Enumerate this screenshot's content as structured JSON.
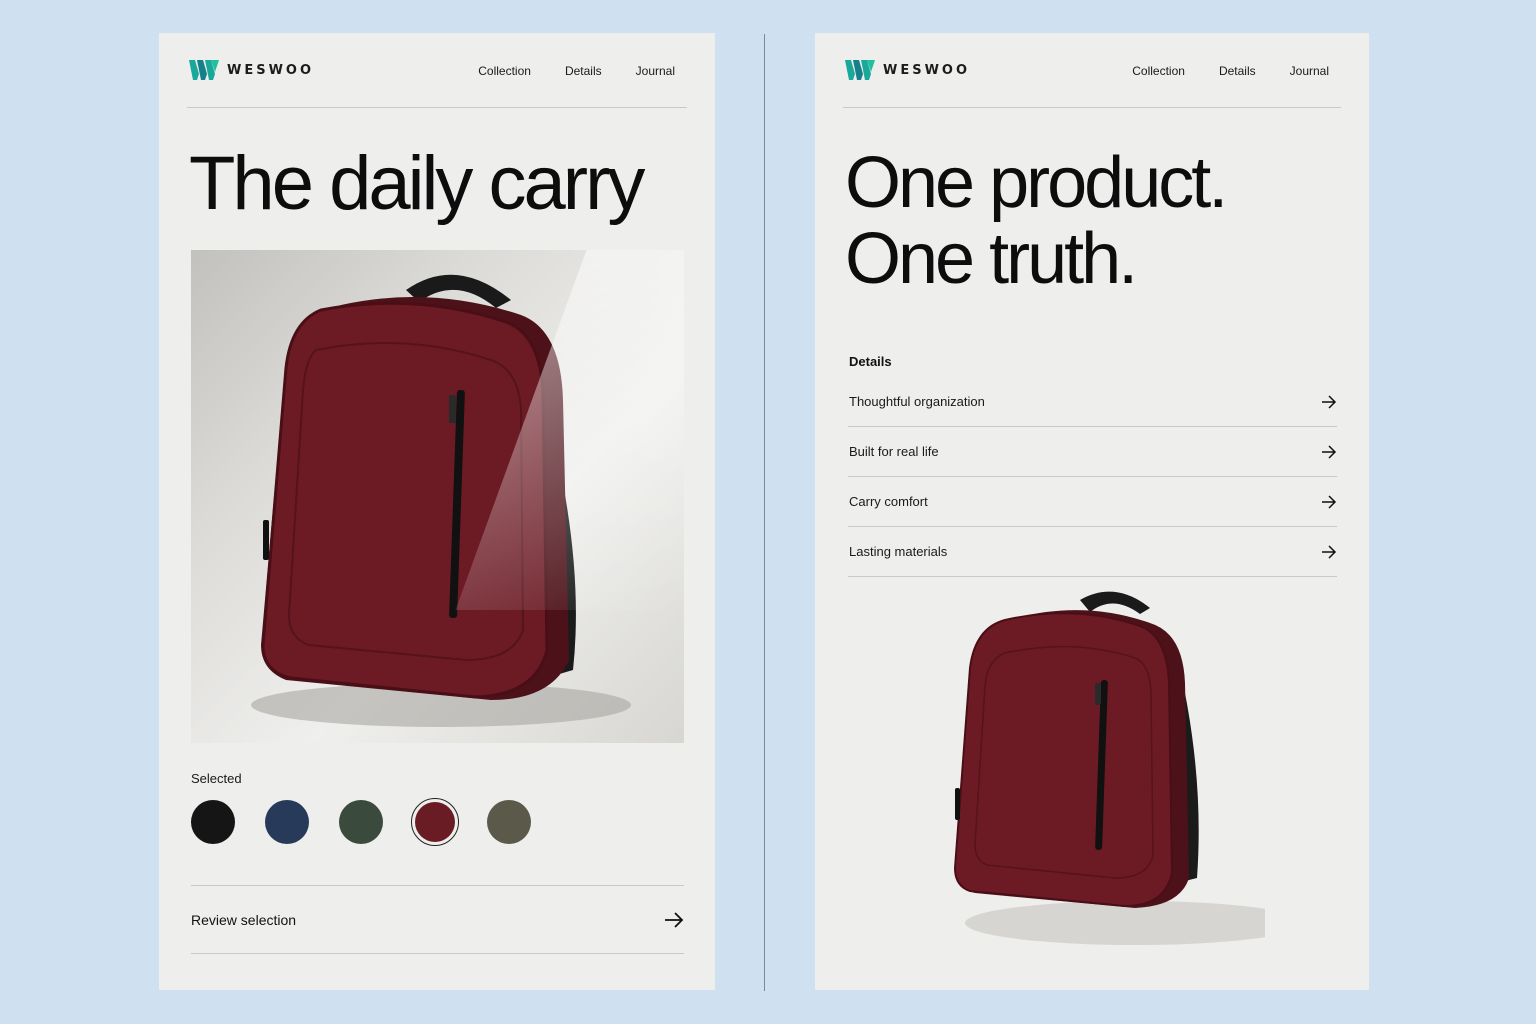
{
  "brand": {
    "name": "WESWOO",
    "accent_color": "#1aa89a",
    "icon": "weswoo-logo-icon"
  },
  "nav": {
    "items": [
      "Collection",
      "Details",
      "Journal"
    ]
  },
  "left_panel": {
    "headline": "The daily carry",
    "product_image": "maroon-backpack",
    "selected_label": "Selected",
    "swatches": [
      {
        "name": "black",
        "color": "#151515"
      },
      {
        "name": "navy",
        "color": "#273a5a"
      },
      {
        "name": "forest-green",
        "color": "#3a4a3c"
      },
      {
        "name": "burgundy",
        "color": "#6a1c24"
      },
      {
        "name": "olive",
        "color": "#5b5a4a"
      }
    ],
    "selected_swatch": "burgundy",
    "review_label": "Review selection",
    "review_icon": "arrow-right-icon"
  },
  "right_panel": {
    "headline_line1": "One product.",
    "headline_line2": "One truth.",
    "details_title": "Details",
    "details": [
      "Thoughtful organization",
      "Built for real life",
      "Carry comfort",
      "Lasting materials"
    ],
    "product_image": "maroon-backpack"
  }
}
